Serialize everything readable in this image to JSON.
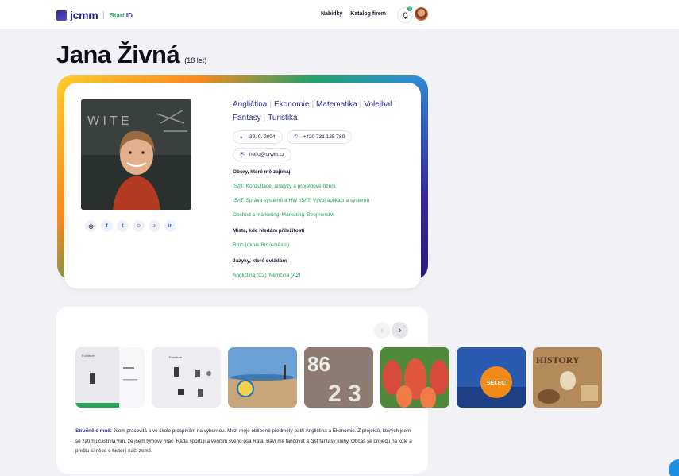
{
  "header": {
    "logo_text": "jcmm",
    "logo_sub": "Start",
    "logo_sub_mark": "ID",
    "nav": [
      "Nabídky",
      "Katalog firem"
    ],
    "notification_count": "0"
  },
  "profile": {
    "name": "Jana Živná",
    "age": "(18 let)",
    "interests": [
      "Angličtina",
      "Ekonomie",
      "Matematika",
      "Volejbal",
      "Fantasy",
      "Turistika"
    ],
    "birthdate": "30. 9. 2004",
    "phone": "+420 731 125 789",
    "email": "hello@orwin.cz",
    "socials": [
      {
        "icon": "instagram-icon",
        "glyph": "◎",
        "color": "#1a1a2e"
      },
      {
        "icon": "facebook-icon",
        "glyph": "f",
        "color": "#1877f2"
      },
      {
        "icon": "twitter-icon",
        "glyph": "t",
        "color": "#1d9bf0"
      },
      {
        "icon": "snapchat-icon",
        "glyph": "☺",
        "color": "#1a1a2e"
      },
      {
        "icon": "tiktok-icon",
        "glyph": "♪",
        "color": "#1a1a2e"
      },
      {
        "icon": "linkedin-icon",
        "glyph": "in",
        "color": "#0a66c2"
      }
    ],
    "fields_heading": "Obory, které mě zajímají",
    "fields": [
      [
        "IS/IT: Konzultace, analýzy a projektové řízení"
      ],
      [
        "IS/IT: Správa systémů a HW",
        "IS/IT: Vývoj aplikací a systémů"
      ],
      [
        "Obchod a marketing",
        "Marketing",
        "Strojírenství"
      ]
    ],
    "places_heading": "Místa, kde hledám příležitosti",
    "places": [
      "Brno (okres Brno-město)"
    ],
    "languages_heading": "Jazyky, které ovládám",
    "languages": [
      "Angličtina (C2)",
      "Němčina (A2)"
    ]
  },
  "gallery": {
    "prev": "‹",
    "next": "›",
    "about_label": "Stručně o mně:",
    "about_text": " Jsem pracovitá a ve škole prospívám na výbornou. Mezi moje oblíbené předměty patří Angličtina a Ekonomie. Z projektů, kterých jsem se zatím účastnila vím, že jsem týmový hráč. Ráda sportuji a venčím svého psa Rafa. Baví mě tancovat a číst fantasy knihy. Občas se projedu na kole a přečtu si něco o historii naší země.",
    "thumbs": [
      "Furniture",
      "Furniture",
      "",
      "",
      "",
      "",
      "HISTORY"
    ]
  },
  "colors": {
    "brand": "#2c2a8c",
    "accent_green": "#20a05a"
  }
}
